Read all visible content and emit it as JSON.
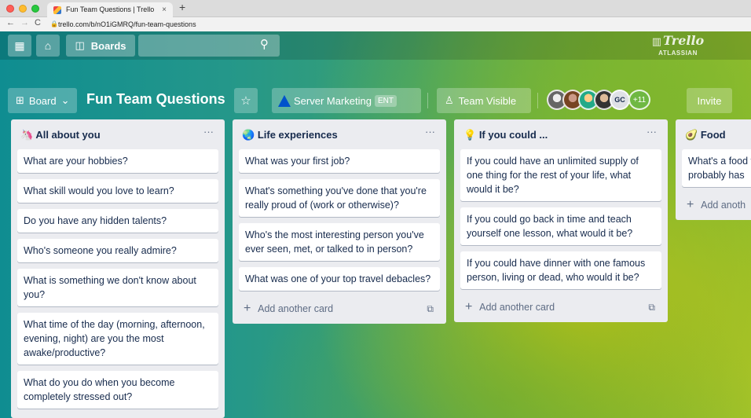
{
  "browser": {
    "tab_title": "Fun Team Questions | Trello",
    "tab_close": "×",
    "new_tab": "+",
    "back": "←",
    "forward": "→",
    "reload": "C",
    "url": "trello.com/b/nO1iGMRQ/fun-team-questions"
  },
  "topnav": {
    "apps_icon": "▦",
    "home_icon": "⌂",
    "boards_icon": "◫",
    "boards_label": "Boards",
    "search_icon": "⚲",
    "logo_text": "Trello",
    "logo_sub": "ATLASSIAN"
  },
  "boardbar": {
    "view_label": "Board",
    "view_caret": "⌄",
    "view_icon": "⊞",
    "title": "Fun Team Questions",
    "star_icon": "☆",
    "team_name": "Server Marketing",
    "team_badge": "ENT",
    "visibility_icon": "♙",
    "visibility_label": "Team Visible",
    "avatar_initials": "GC",
    "more_members": "+11",
    "invite_label": "Invite"
  },
  "lists": [
    {
      "emoji": "🦄",
      "title": "All about you",
      "menu": "···",
      "cards": [
        "What are your hobbies?",
        "What skill would you love to learn?",
        "Do you have any hidden talents?",
        "Who's someone you really admire?",
        "What is something we don't know about you?",
        "What time of the day (morning, afternoon, evening, night) are you the most awake/productive?",
        "What do you do when you become completely stressed out?"
      ]
    },
    {
      "emoji": "🌏",
      "title": "Life experiences",
      "menu": "···",
      "cards": [
        "What was your first job?",
        "What's something you've done that you're really proud of (work or otherwise)?",
        "Who's the most interesting person you've ever seen, met, or talked to in person?",
        "What was one of your top travel debacles?"
      ],
      "add_card": "Add another card"
    },
    {
      "emoji": "💡",
      "title": "If you could ...",
      "menu": "···",
      "cards": [
        "If you could have an unlimited supply of one thing for the rest of your life, what would it be?",
        "If you could go back in time and teach yourself one lesson, what would it be?",
        "If you could have dinner with one famous person, living or dead, who would it be?"
      ],
      "add_card": "Add another card"
    },
    {
      "emoji": "🥑",
      "title": "Food",
      "cards": [
        "What's a food that probably has"
      ],
      "add_card": "Add anoth"
    }
  ],
  "add_plus": "+",
  "template_icon": "⧉"
}
